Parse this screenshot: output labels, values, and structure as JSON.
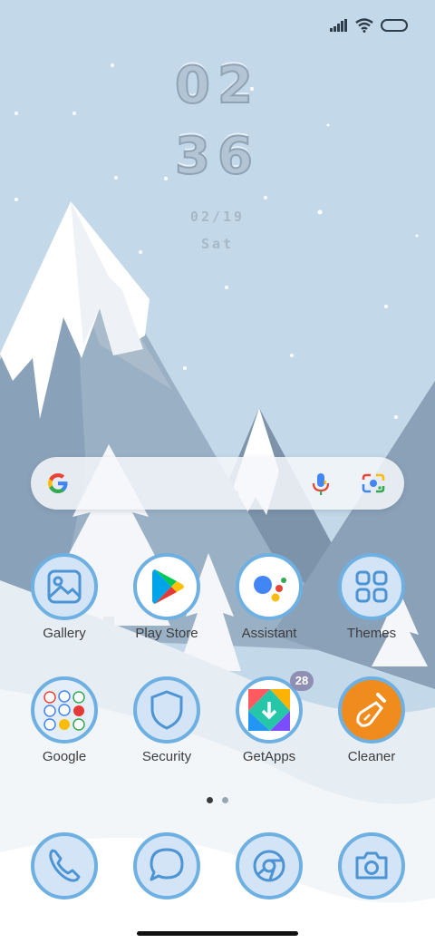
{
  "clock": {
    "hours": "02",
    "minutes": "36",
    "date": "02/19",
    "weekday": "Sat"
  },
  "status_bar": {
    "icons": [
      "signal-icon",
      "wifi-icon",
      "battery-icon"
    ]
  },
  "search": {
    "icons": [
      "google-logo",
      "microphone-icon",
      "lens-camera-icon"
    ]
  },
  "apps": {
    "gallery": "Gallery",
    "play_store": "Play Store",
    "assistant": "Assistant",
    "themes": "Themes",
    "google": "Google",
    "security": "Security",
    "getapps": "GetApps",
    "getapps_badge": "28",
    "cleaner": "Cleaner"
  },
  "dock": {
    "icons": [
      "phone-icon",
      "messages-icon",
      "chrome-icon",
      "camera-icon"
    ]
  },
  "page_indicator": {
    "count": 2,
    "active_index": 0
  },
  "colors": {
    "sky": "#c3d8e8",
    "icon_ring": "#6fb0e2",
    "icon_fill": "#d2e4f5",
    "label": "#3d3d3d"
  }
}
